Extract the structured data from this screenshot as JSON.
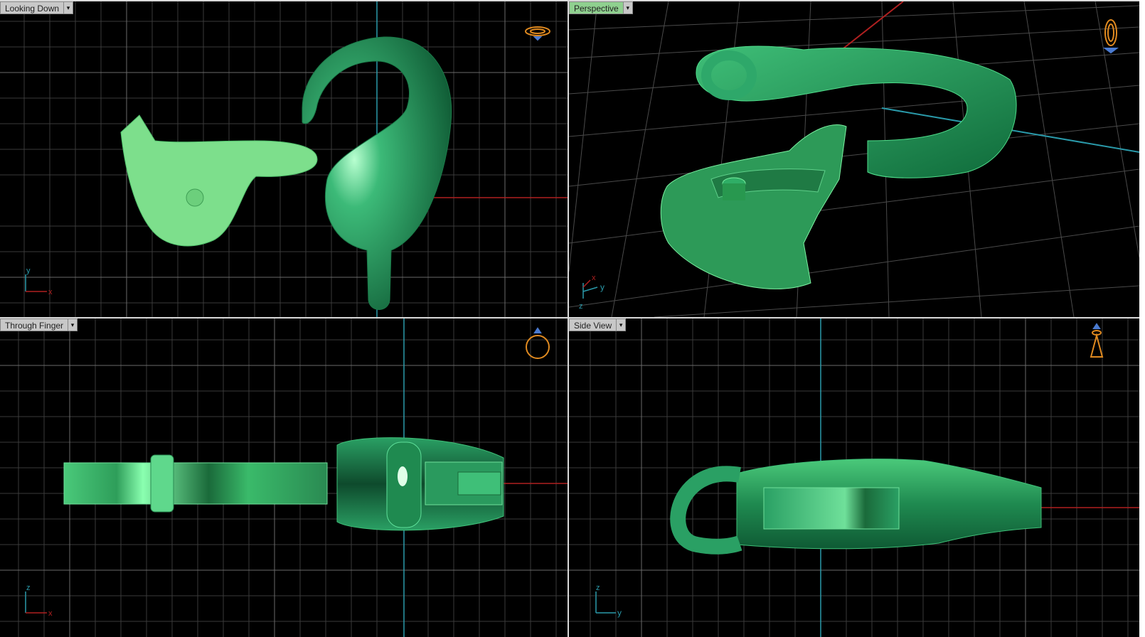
{
  "viewports": {
    "top": {
      "title": "Looking Down",
      "axis_h": "x",
      "axis_v": "y"
    },
    "perspective": {
      "title": "Perspective",
      "axis_h": "y",
      "axis_v": "z",
      "axis_d": "x"
    },
    "front": {
      "title": "Through Finger",
      "axis_h": "x",
      "axis_v": "z"
    },
    "side": {
      "title": "Side View",
      "axis_h": "y",
      "axis_v": "z"
    }
  },
  "icons": {
    "dropdown": "chevron-down-icon",
    "view_cube": "ring-orientation-icon"
  },
  "colors": {
    "background": "#000000",
    "grid": "#3a3a3a",
    "axis_x": "#b02020",
    "axis_y": "#2a9aaa",
    "model": "#2e9a5a",
    "model_light": "#7fe08f",
    "active_title": "#8fd08f",
    "orientation_icon": "#e08a20"
  }
}
